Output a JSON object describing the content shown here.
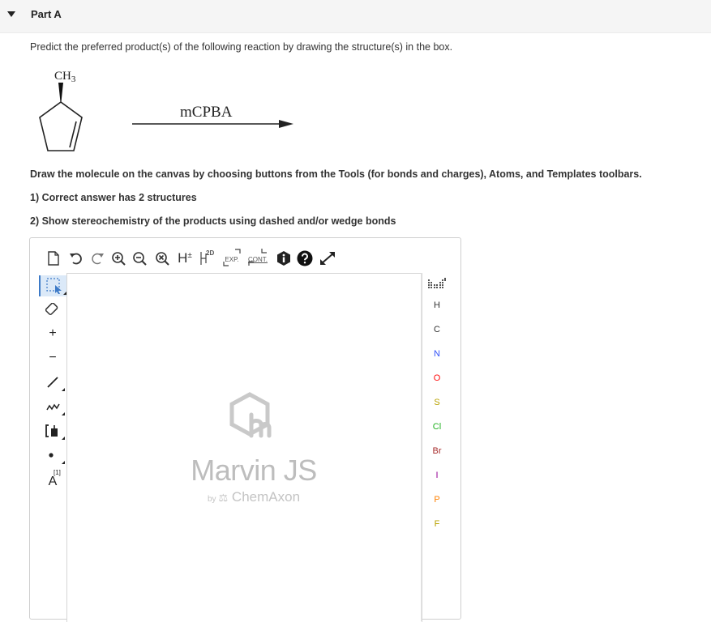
{
  "part": {
    "title": "Part A"
  },
  "question": "Predict the preferred product(s) of the following reaction by drawing the structure(s) in the box.",
  "reaction": {
    "substituent": "CH3",
    "reagent": "mCPBA"
  },
  "instructions": [
    "Draw the molecule on the canvas by choosing buttons from the Tools (for bonds and charges), Atoms, and Templates toolbars.",
    "1) Correct answer has 2 structures",
    "2) Show stereochemistry of the products using dashed and/or wedge bonds"
  ],
  "editor": {
    "top_toolbar": {
      "h_label": "H",
      "h_mark": "±",
      "label_2d": "2D",
      "label_exp": "EXP.",
      "label_cont": "CONT."
    },
    "left_toolbar": {
      "charge_plus": "+",
      "charge_minus": "−",
      "atom_label": "A",
      "atom_map": "[1]"
    },
    "elements": [
      "H",
      "C",
      "N",
      "O",
      "S",
      "Cl",
      "Br",
      "I",
      "P",
      "F"
    ],
    "element_colors": {
      "H": "#333333",
      "C": "#333333",
      "N": "#3050F8",
      "O": "#FF0D0D",
      "S": "#B8A200",
      "Cl": "#1FB01F",
      "Br": "#A62929",
      "I": "#940094",
      "P": "#FF8000",
      "F": "#B8A200"
    },
    "watermark": {
      "title": "Marvin JS",
      "by": "by",
      "company": "ChemAxon"
    }
  }
}
